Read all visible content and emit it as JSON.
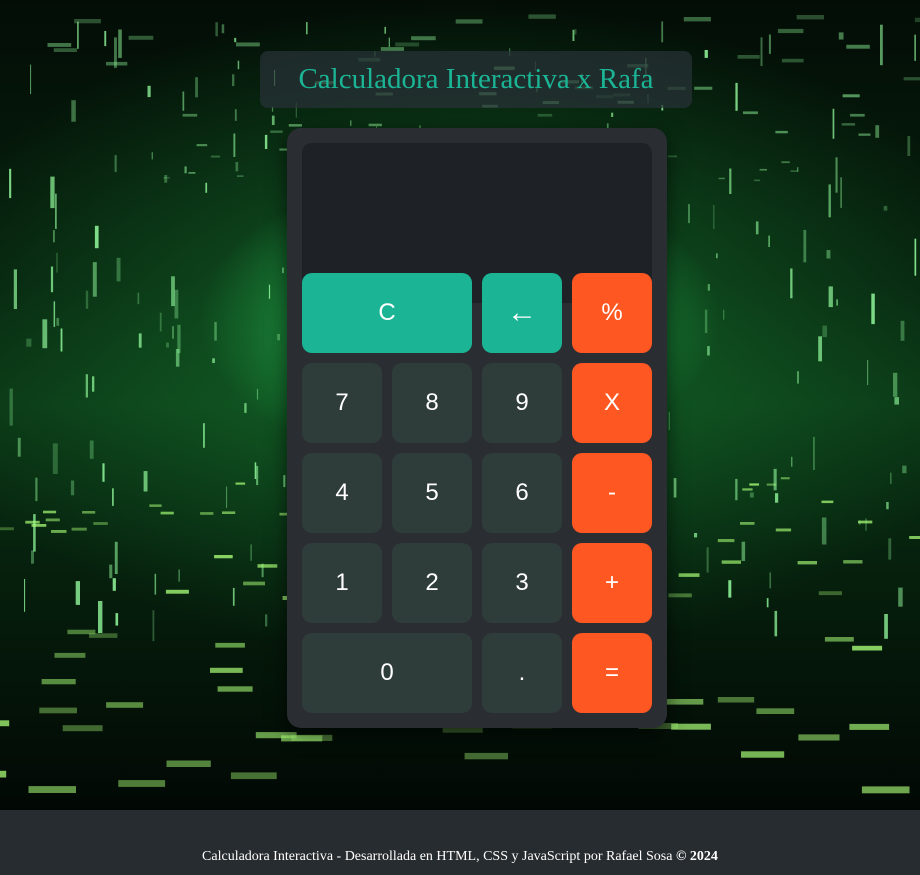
{
  "header": {
    "title": "Calculadora Interactiva x Rafa"
  },
  "display": {
    "value": ""
  },
  "keypad": {
    "clear": "C",
    "backspace": "←",
    "percent": "%",
    "seven": "7",
    "eight": "8",
    "nine": "9",
    "multiply": "X",
    "four": "4",
    "five": "5",
    "six": "6",
    "subtract": "-",
    "one": "1",
    "two": "2",
    "three": "3",
    "add": "+",
    "zero": "0",
    "decimal": ".",
    "equals": "="
  },
  "footer": {
    "text": "Calculadora Interactiva - Desarrollada en HTML, CSS y JavaScript por Rafael Sosa",
    "copyright": "© 2024"
  },
  "colors": {
    "accent_teal": "#1bb596",
    "operator_orange": "#ff5722",
    "number_key": "#2e3c3a",
    "calculator_body": "#2a2e33",
    "display_bg": "#1e2226",
    "footer_bg": "#272c30"
  },
  "background": {
    "description_icon": "digital-matrix-tunnel-background"
  }
}
